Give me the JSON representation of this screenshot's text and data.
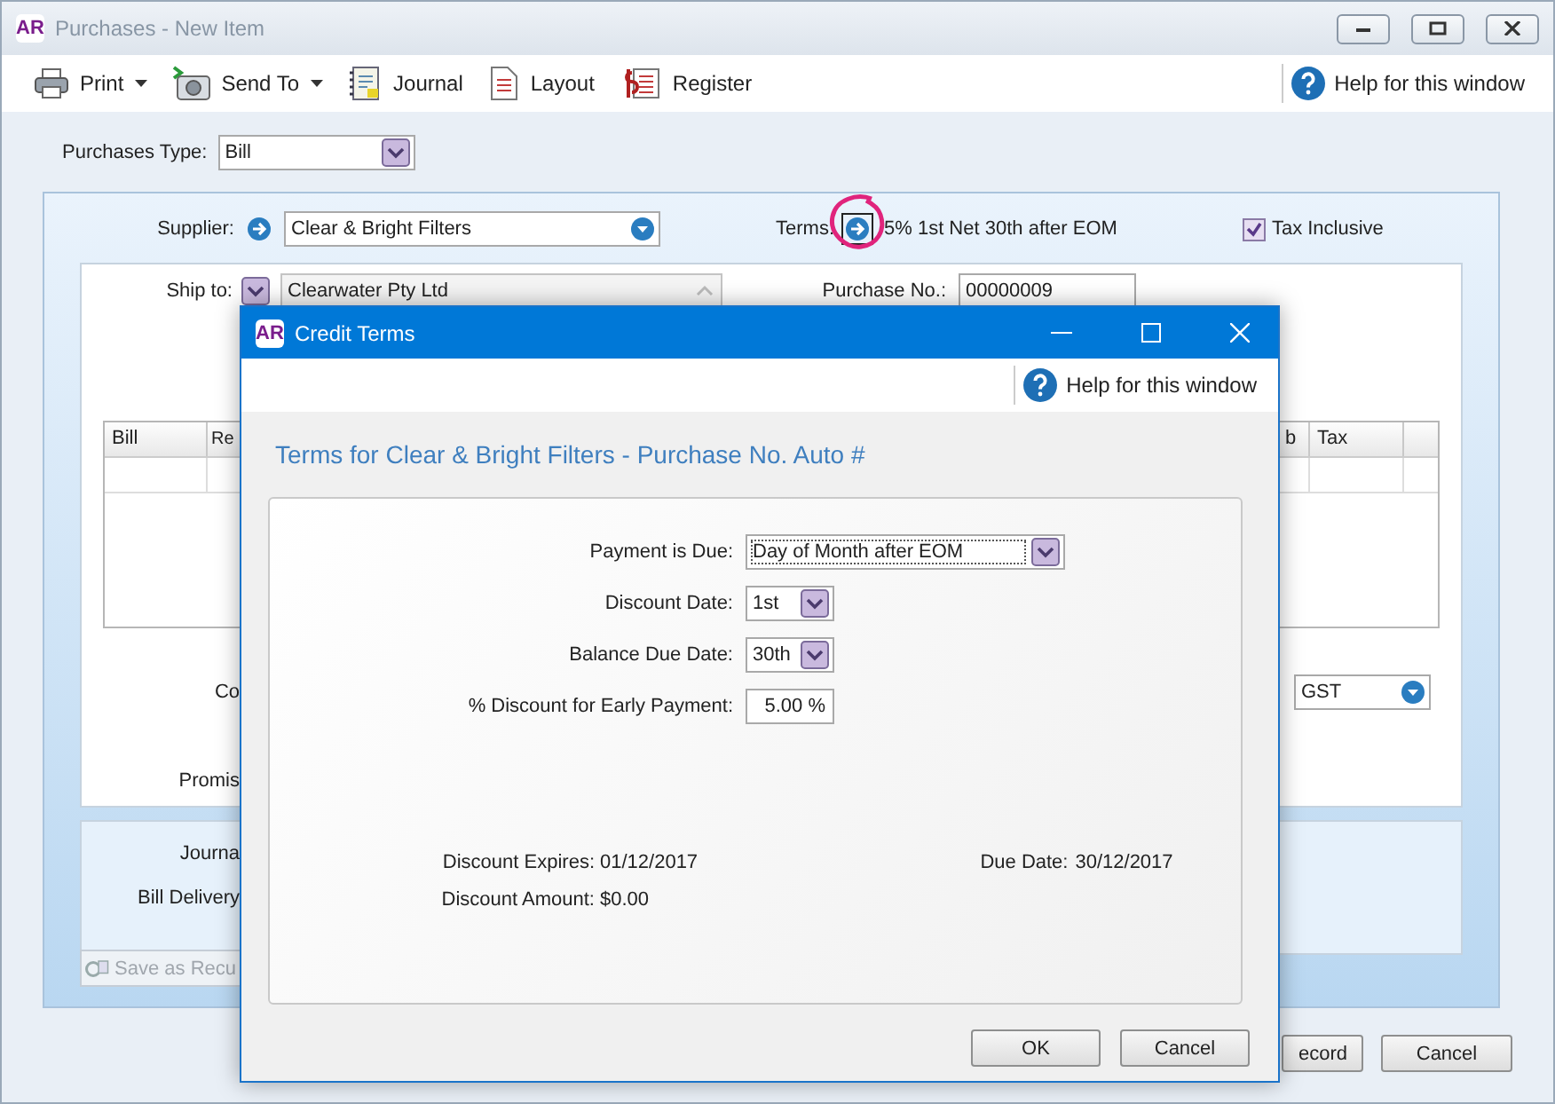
{
  "window": {
    "logo": "AR",
    "title": "Purchases - New Item"
  },
  "toolbar": [
    {
      "label": "Print",
      "kind": "menu"
    },
    {
      "label": "Send To",
      "kind": "menu"
    },
    {
      "label": "Journal",
      "kind": "plain"
    },
    {
      "label": "Layout",
      "kind": "plain"
    },
    {
      "label": "Register",
      "kind": "plain"
    }
  ],
  "help": "Help for this window",
  "purchases_type": {
    "label": "Purchases Type:",
    "value": "Bill"
  },
  "supplier": {
    "label": "Supplier:",
    "value": "Clear & Bright Filters"
  },
  "terms": {
    "label": "Terms:",
    "value": "5% 1st Net 30th after EOM"
  },
  "tax_inclusive": {
    "label": "Tax Inclusive",
    "checked": true
  },
  "ship_to": {
    "label": "Ship to:",
    "value": "Clearwater Pty Ltd"
  },
  "purchase_no": {
    "label": "Purchase No.:",
    "value": "00000009"
  },
  "table": {
    "columns": [
      "Bill",
      "Re",
      "b",
      "Tax"
    ]
  },
  "field_label_1": "Co",
  "tax_code": "GST",
  "field_label_2": "Promis",
  "journal_label": "Journa",
  "delivery_label": "Bill Delivery",
  "save_recurring": {
    "label": "Save as Recu",
    "disabled": true
  },
  "buttons": [
    "ecord",
    "Cancel"
  ],
  "dialog": {
    "logo": "AR",
    "title": "Credit Terms",
    "help": "Help for this window",
    "heading": "Terms for Clear & Bright Filters - Purchase No. Auto #",
    "fields": [
      {
        "label": "Payment is Due:",
        "value": "Day of Month after EOM",
        "kind": "wide-select"
      },
      {
        "label": "Discount Date:",
        "value": "1st",
        "kind": "select"
      },
      {
        "label": "Balance Due Date:",
        "value": "30th",
        "kind": "select"
      },
      {
        "label": "% Discount for Early Payment:",
        "value": "5.00 %",
        "kind": "input"
      }
    ],
    "discount_expires": {
      "label": "Discount Expires:",
      "value": "01/12/2017"
    },
    "due_date": {
      "label": "Due Date:",
      "value": "30/12/2017"
    },
    "discount_amount": {
      "label": "Discount Amount:",
      "value": "$0.00"
    },
    "buttons": [
      "OK",
      "Cancel"
    ]
  }
}
